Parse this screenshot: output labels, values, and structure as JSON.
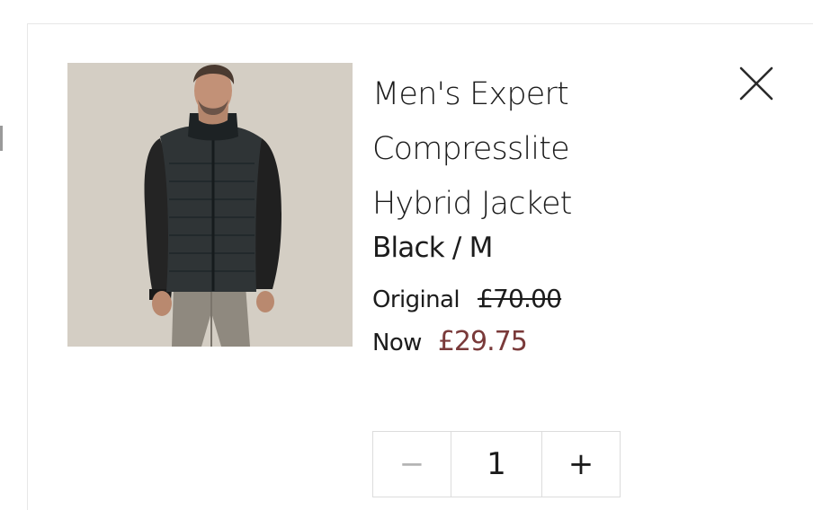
{
  "product": {
    "title": "Men's Expert Compresslite Hybrid Jacket",
    "variant": "Black / M",
    "image_alt": "Man wearing black hybrid jacket",
    "original_label": "Original",
    "original_price": "£70.00",
    "now_label": "Now",
    "now_price": "£29.75",
    "sale_color": "#7a3a3a"
  },
  "quantity": {
    "decrement_label": "−",
    "value": "1",
    "increment_label": "+"
  },
  "icons": {
    "close": "close-icon",
    "decrement": "minus-icon",
    "increment": "plus-icon"
  }
}
